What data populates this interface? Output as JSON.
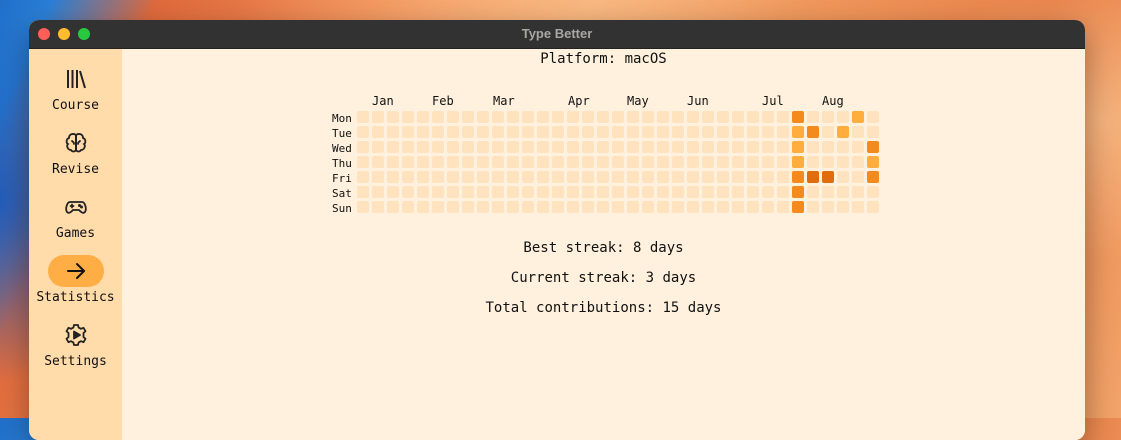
{
  "window": {
    "title": "Type Better"
  },
  "sidebar": {
    "items": [
      {
        "label": "Course",
        "icon": "library-icon",
        "active": false
      },
      {
        "label": "Revise",
        "icon": "brain-icon",
        "active": false
      },
      {
        "label": "Games",
        "icon": "gamepad-icon",
        "active": false
      },
      {
        "label": "Statistics",
        "icon": "arrow-right-icon",
        "active": true
      },
      {
        "label": "Settings",
        "icon": "gear-play-icon",
        "active": false
      }
    ]
  },
  "main": {
    "platform": "Platform: macOS",
    "heatmap": {
      "months": [
        "Jan",
        "Feb",
        "Mar",
        "Apr",
        "May",
        "Jun",
        "Jul",
        "Aug"
      ],
      "days": [
        "Mon",
        "Tue",
        "Wed",
        "Thu",
        "Fri",
        "Sat",
        "Sun"
      ],
      "weeks": 35,
      "colors": {
        "empty": "#ffe3bf",
        "level1": "#ffad3d",
        "level2": "#f48a1c",
        "level3": "#e06c0c"
      },
      "contributions": [
        {
          "week": 29,
          "day": 0,
          "level": 2
        },
        {
          "week": 33,
          "day": 0,
          "level": 1
        },
        {
          "week": 29,
          "day": 1,
          "level": 1
        },
        {
          "week": 30,
          "day": 1,
          "level": 2
        },
        {
          "week": 32,
          "day": 1,
          "level": 1
        },
        {
          "week": 29,
          "day": 2,
          "level": 1
        },
        {
          "week": 34,
          "day": 2,
          "level": 2
        },
        {
          "week": 29,
          "day": 3,
          "level": 1
        },
        {
          "week": 34,
          "day": 3,
          "level": 1
        },
        {
          "week": 29,
          "day": 4,
          "level": 2
        },
        {
          "week": 30,
          "day": 4,
          "level": 3
        },
        {
          "week": 31,
          "day": 4,
          "level": 3
        },
        {
          "week": 34,
          "day": 4,
          "level": 2
        },
        {
          "week": 29,
          "day": 5,
          "level": 2
        },
        {
          "week": 29,
          "day": 6,
          "level": 2
        }
      ]
    },
    "best_streak": "Best streak: 8 days",
    "current_streak": "Current streak: 3 days",
    "total_contributions": "Total contributions: 15 days"
  }
}
